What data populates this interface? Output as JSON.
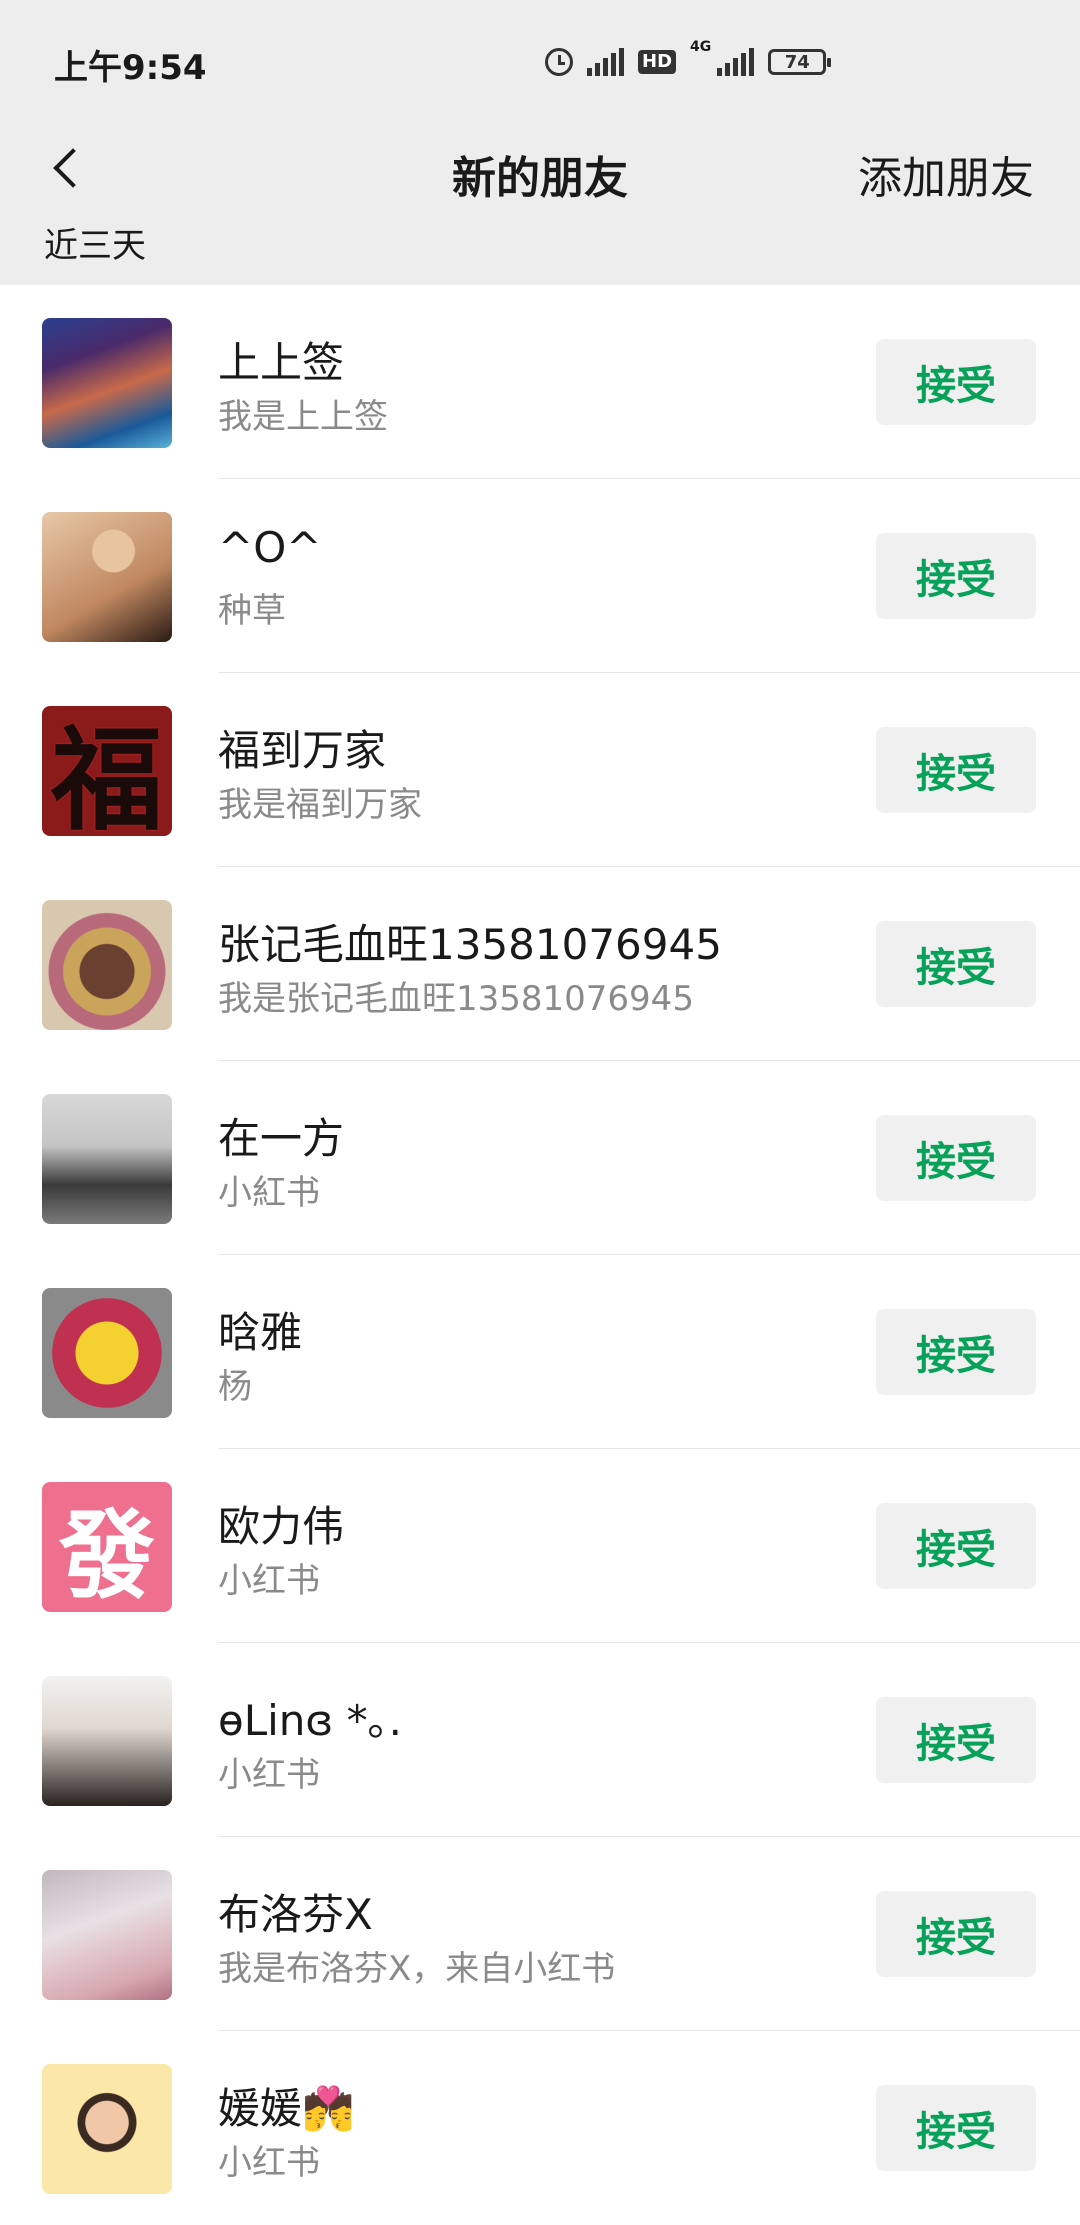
{
  "status_bar": {
    "time": "上午9:54",
    "network": "4G",
    "hd": "HD",
    "battery": "74"
  },
  "nav": {
    "title": "新的朋友",
    "add_friend": "添加朋友"
  },
  "section_title": "近三天",
  "accept_label": "接受",
  "requests": [
    {
      "name": "上上签",
      "message": "我是上上签"
    },
    {
      "name": "^O^",
      "message": "种草"
    },
    {
      "name": "福到万家",
      "message": "我是福到万家"
    },
    {
      "name": "张记毛血旺13581076945",
      "message": "我是张记毛血旺13581076945"
    },
    {
      "name": "在一方",
      "message": "小紅书"
    },
    {
      "name": "晗雅",
      "message": "杨"
    },
    {
      "name": "欧力伟",
      "message": "小红书"
    },
    {
      "name": "ɵLinɞ *｡.",
      "message": "小红书"
    },
    {
      "name": "布洛芬X",
      "message": "我是布洛芬X，来自小红书"
    },
    {
      "name": "媛媛💏",
      "message": "小红书"
    }
  ],
  "avatar_text": {
    "fu": "福",
    "fa": "發"
  },
  "colors": {
    "accept_text": "#07a159",
    "header_bg": "#ededed"
  }
}
